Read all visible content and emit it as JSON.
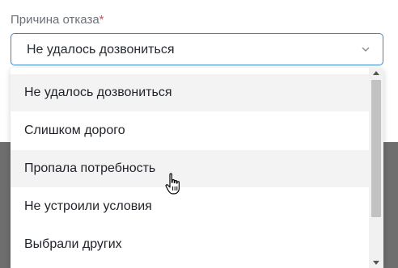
{
  "field": {
    "label": "Причина отказа",
    "required_mark": "*",
    "selected_value": "Не удалось дозвониться"
  },
  "dropdown": {
    "options": [
      {
        "label": "Не удалось дозвониться",
        "state": "selected"
      },
      {
        "label": "Слишком дорого"
      },
      {
        "label": "Пропала потребность",
        "state": "hovered"
      },
      {
        "label": "Не устроили условия"
      },
      {
        "label": "Выбрали других"
      }
    ]
  },
  "colors": {
    "focus_border": "#3a86d6",
    "required": "#e5484d",
    "highlight_row": "#f3f3f3",
    "backdrop": "#6e6e6e"
  },
  "icons": [
    "chevron-down-icon",
    "scroll-up-icon",
    "scroll-down-icon",
    "hand-pointer-icon"
  ]
}
